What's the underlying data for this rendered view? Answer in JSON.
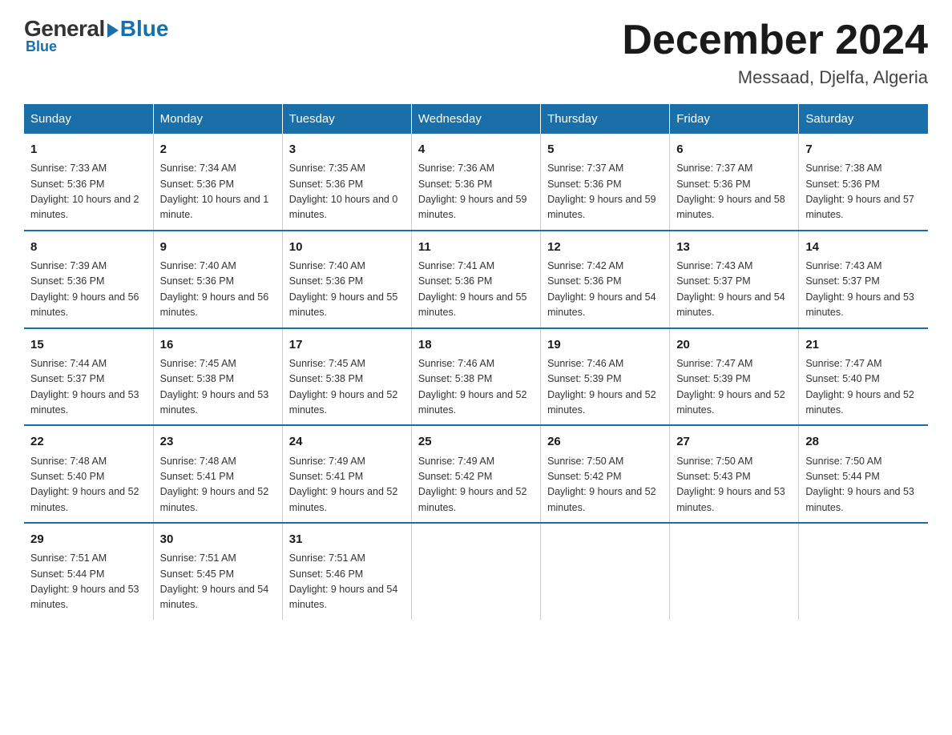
{
  "logo": {
    "general": "General",
    "blue": "Blue"
  },
  "title": "December 2024",
  "location": "Messaad, Djelfa, Algeria",
  "headers": [
    "Sunday",
    "Monday",
    "Tuesday",
    "Wednesday",
    "Thursday",
    "Friday",
    "Saturday"
  ],
  "weeks": [
    [
      {
        "day": "1",
        "sunrise": "7:33 AM",
        "sunset": "5:36 PM",
        "daylight": "10 hours and 2 minutes."
      },
      {
        "day": "2",
        "sunrise": "7:34 AM",
        "sunset": "5:36 PM",
        "daylight": "10 hours and 1 minute."
      },
      {
        "day": "3",
        "sunrise": "7:35 AM",
        "sunset": "5:36 PM",
        "daylight": "10 hours and 0 minutes."
      },
      {
        "day": "4",
        "sunrise": "7:36 AM",
        "sunset": "5:36 PM",
        "daylight": "9 hours and 59 minutes."
      },
      {
        "day": "5",
        "sunrise": "7:37 AM",
        "sunset": "5:36 PM",
        "daylight": "9 hours and 59 minutes."
      },
      {
        "day": "6",
        "sunrise": "7:37 AM",
        "sunset": "5:36 PM",
        "daylight": "9 hours and 58 minutes."
      },
      {
        "day": "7",
        "sunrise": "7:38 AM",
        "sunset": "5:36 PM",
        "daylight": "9 hours and 57 minutes."
      }
    ],
    [
      {
        "day": "8",
        "sunrise": "7:39 AM",
        "sunset": "5:36 PM",
        "daylight": "9 hours and 56 minutes."
      },
      {
        "day": "9",
        "sunrise": "7:40 AM",
        "sunset": "5:36 PM",
        "daylight": "9 hours and 56 minutes."
      },
      {
        "day": "10",
        "sunrise": "7:40 AM",
        "sunset": "5:36 PM",
        "daylight": "9 hours and 55 minutes."
      },
      {
        "day": "11",
        "sunrise": "7:41 AM",
        "sunset": "5:36 PM",
        "daylight": "9 hours and 55 minutes."
      },
      {
        "day": "12",
        "sunrise": "7:42 AM",
        "sunset": "5:36 PM",
        "daylight": "9 hours and 54 minutes."
      },
      {
        "day": "13",
        "sunrise": "7:43 AM",
        "sunset": "5:37 PM",
        "daylight": "9 hours and 54 minutes."
      },
      {
        "day": "14",
        "sunrise": "7:43 AM",
        "sunset": "5:37 PM",
        "daylight": "9 hours and 53 minutes."
      }
    ],
    [
      {
        "day": "15",
        "sunrise": "7:44 AM",
        "sunset": "5:37 PM",
        "daylight": "9 hours and 53 minutes."
      },
      {
        "day": "16",
        "sunrise": "7:45 AM",
        "sunset": "5:38 PM",
        "daylight": "9 hours and 53 minutes."
      },
      {
        "day": "17",
        "sunrise": "7:45 AM",
        "sunset": "5:38 PM",
        "daylight": "9 hours and 52 minutes."
      },
      {
        "day": "18",
        "sunrise": "7:46 AM",
        "sunset": "5:38 PM",
        "daylight": "9 hours and 52 minutes."
      },
      {
        "day": "19",
        "sunrise": "7:46 AM",
        "sunset": "5:39 PM",
        "daylight": "9 hours and 52 minutes."
      },
      {
        "day": "20",
        "sunrise": "7:47 AM",
        "sunset": "5:39 PM",
        "daylight": "9 hours and 52 minutes."
      },
      {
        "day": "21",
        "sunrise": "7:47 AM",
        "sunset": "5:40 PM",
        "daylight": "9 hours and 52 minutes."
      }
    ],
    [
      {
        "day": "22",
        "sunrise": "7:48 AM",
        "sunset": "5:40 PM",
        "daylight": "9 hours and 52 minutes."
      },
      {
        "day": "23",
        "sunrise": "7:48 AM",
        "sunset": "5:41 PM",
        "daylight": "9 hours and 52 minutes."
      },
      {
        "day": "24",
        "sunrise": "7:49 AM",
        "sunset": "5:41 PM",
        "daylight": "9 hours and 52 minutes."
      },
      {
        "day": "25",
        "sunrise": "7:49 AM",
        "sunset": "5:42 PM",
        "daylight": "9 hours and 52 minutes."
      },
      {
        "day": "26",
        "sunrise": "7:50 AM",
        "sunset": "5:42 PM",
        "daylight": "9 hours and 52 minutes."
      },
      {
        "day": "27",
        "sunrise": "7:50 AM",
        "sunset": "5:43 PM",
        "daylight": "9 hours and 53 minutes."
      },
      {
        "day": "28",
        "sunrise": "7:50 AM",
        "sunset": "5:44 PM",
        "daylight": "9 hours and 53 minutes."
      }
    ],
    [
      {
        "day": "29",
        "sunrise": "7:51 AM",
        "sunset": "5:44 PM",
        "daylight": "9 hours and 53 minutes."
      },
      {
        "day": "30",
        "sunrise": "7:51 AM",
        "sunset": "5:45 PM",
        "daylight": "9 hours and 54 minutes."
      },
      {
        "day": "31",
        "sunrise": "7:51 AM",
        "sunset": "5:46 PM",
        "daylight": "9 hours and 54 minutes."
      },
      null,
      null,
      null,
      null
    ]
  ]
}
